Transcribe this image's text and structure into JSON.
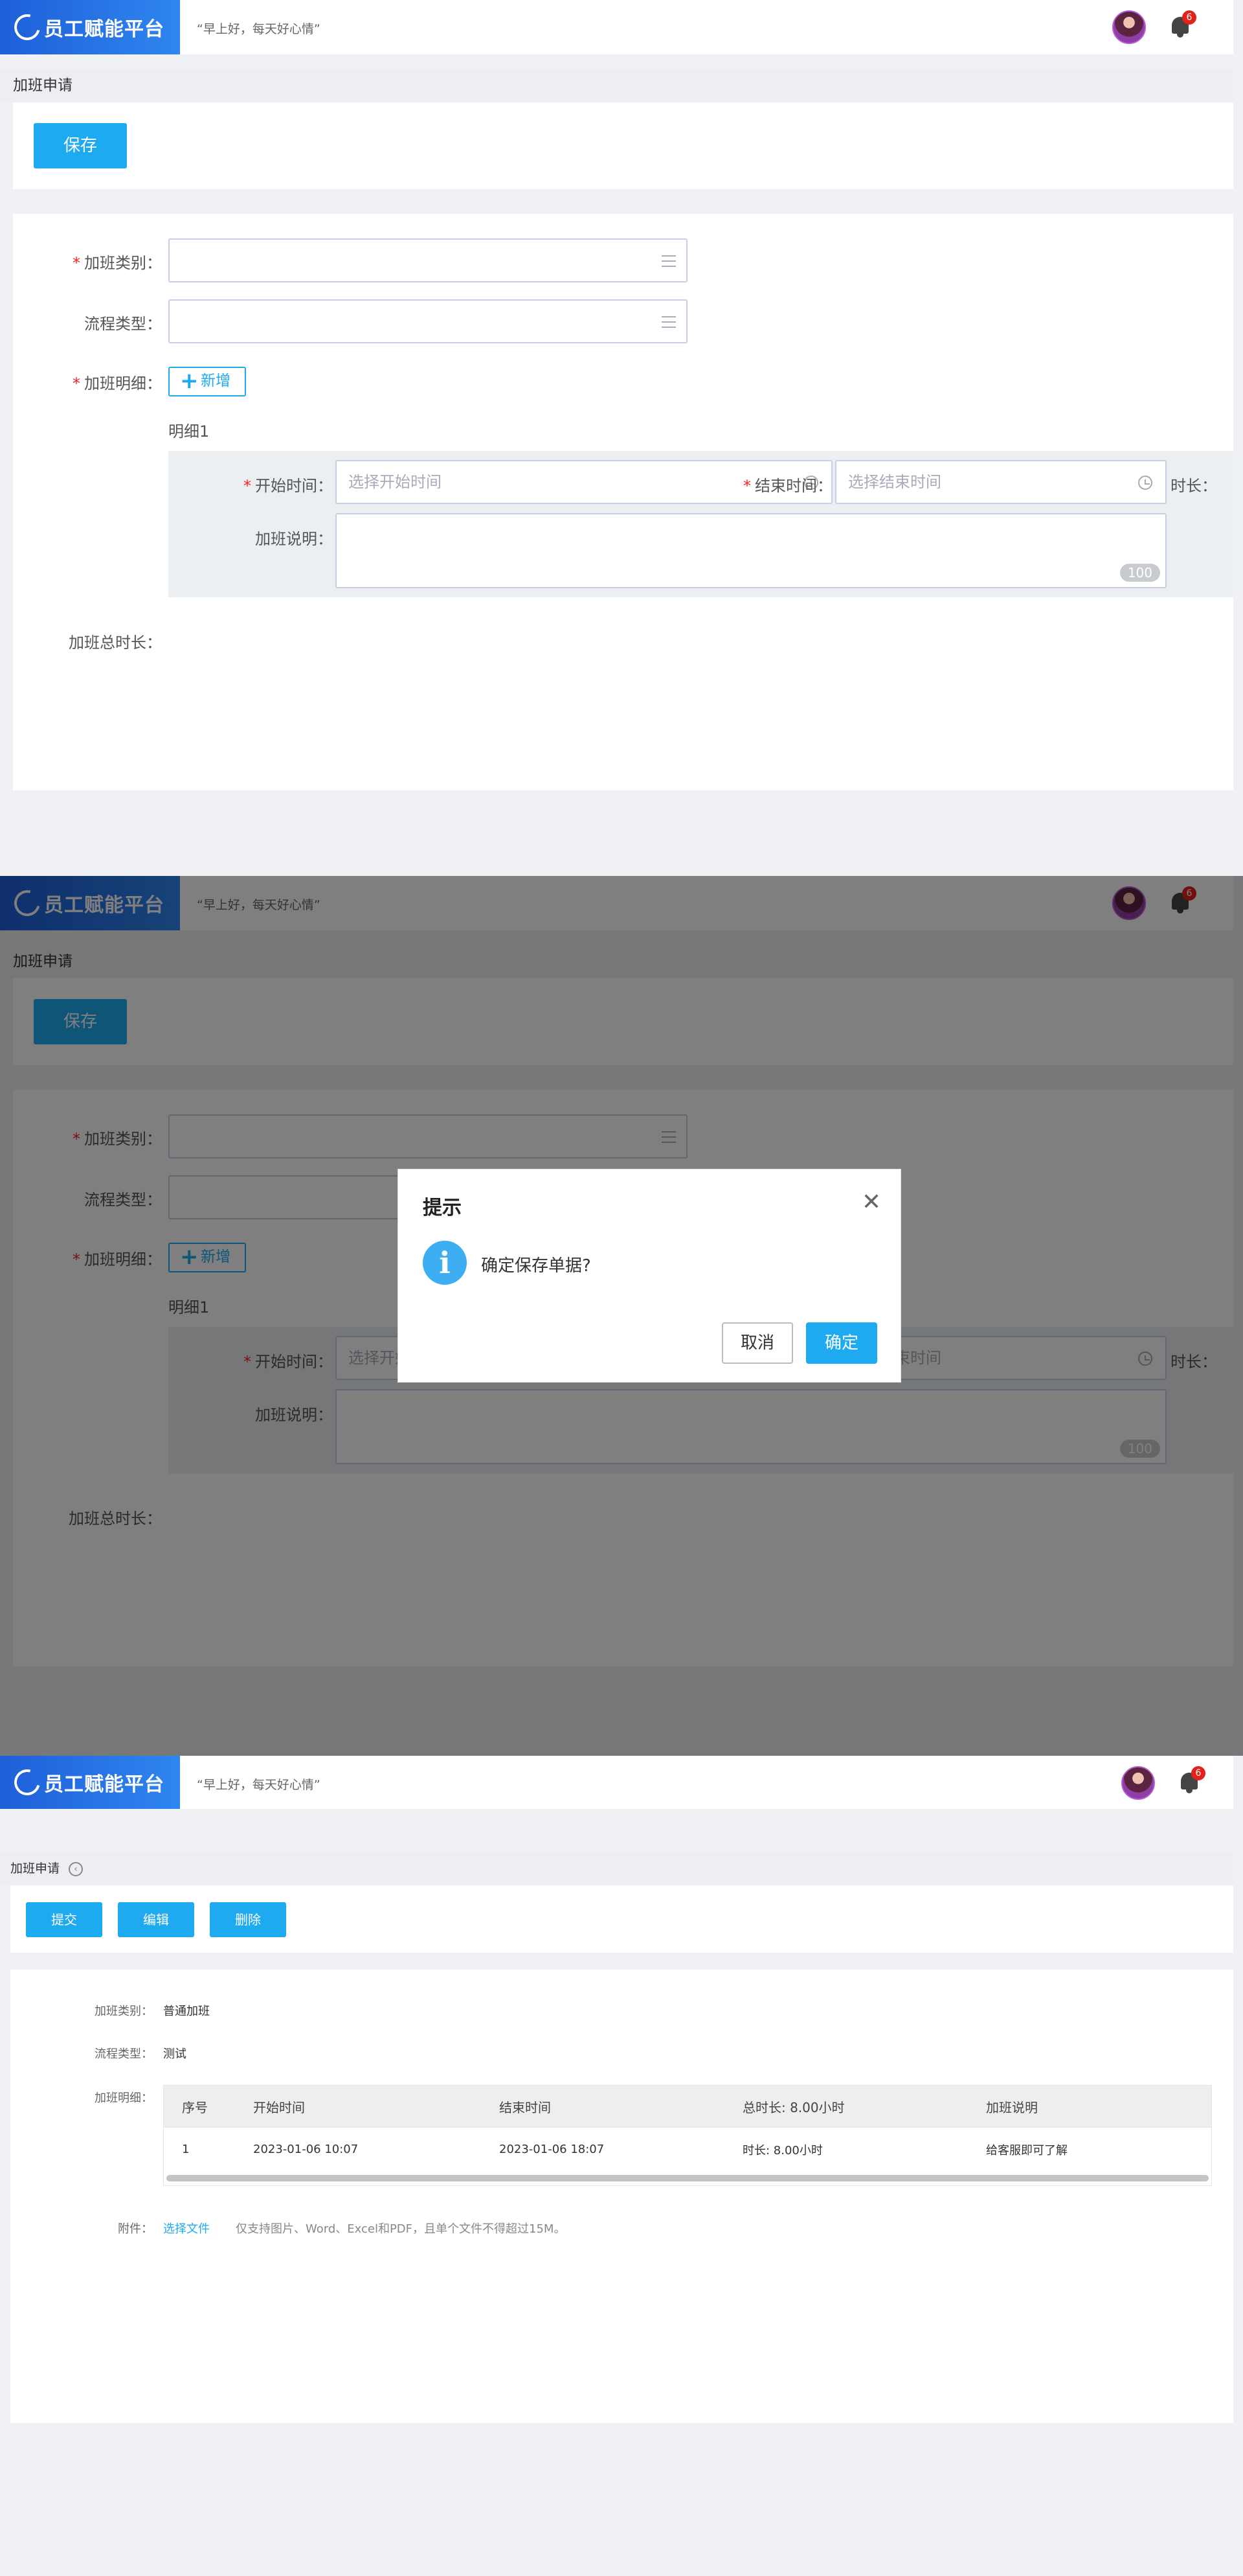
{
  "app": {
    "brand": "员工赋能平台",
    "greeting": "“早上好，每天好心情”",
    "notification_count": "6"
  },
  "form": {
    "page_title": "加班申请",
    "save_label": "保存",
    "category_label": "加班类别：",
    "process_label": "流程类型：",
    "detail_label": "加班明细：",
    "add_label": "新增",
    "detail_title": "明细1",
    "start_label": "开始时间：",
    "start_placeholder": "选择开始时间",
    "end_label": "结束时间：",
    "end_placeholder": "选择结束时间",
    "duration_label": "时长：",
    "remark_label": "加班说明：",
    "remark_count": "100",
    "total_label": "加班总时长："
  },
  "dialog": {
    "title": "提示",
    "message": "确定保存单据?",
    "cancel_label": "取消",
    "ok_label": "确定"
  },
  "view": {
    "page_title": "加班申请",
    "submit_label": "提交",
    "edit_label": "编辑",
    "delete_label": "删除",
    "category_label": "加班类别：",
    "category_value": "普通加班",
    "process_label": "流程类型：",
    "process_value": "测试",
    "detail_label": "加班明细：",
    "table": {
      "headers": [
        "序号",
        "开始时间",
        "结束时间",
        "总时长: 8.00小时",
        "加班说明"
      ],
      "rows": [
        [
          "1",
          "2023-01-06 10:07",
          "2023-01-06 18:07",
          "时长: 8.00小时",
          "给客服即可了解"
        ]
      ]
    },
    "attachment_label": "附件：",
    "select_file_label": "选择文件",
    "attachment_hint": "仅支持图片、Word、Excel和PDF，且单个文件不得超过15M。"
  }
}
